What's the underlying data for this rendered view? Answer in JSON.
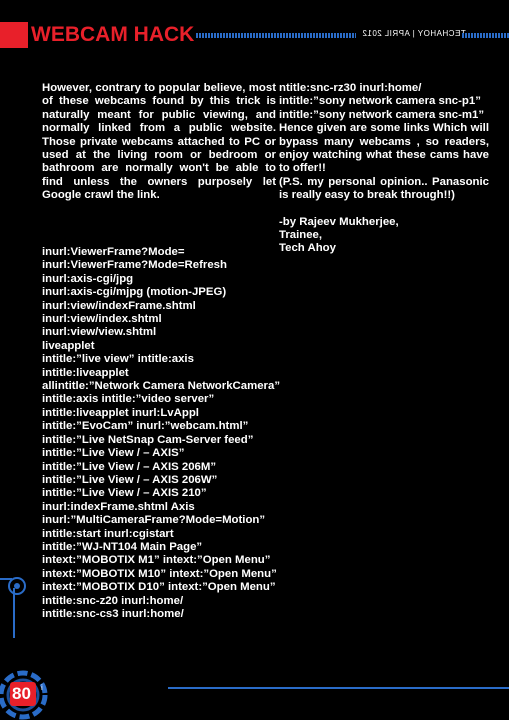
{
  "header": {
    "title": "WEBCAM HACK",
    "issue": "TECHAHOY | APRIL 2012"
  },
  "article": {
    "intro": "However, contrary to popular believe, most of these webcams found by this trick is naturally meant for public viewing, and normally linked from a public website. Those private webcams attached to PC or used at the living room or bedroom or bathroom are normally won't be able to find unless the owners purposely let Google crawl the link.",
    "dorks": [
      "inurl:ViewerFrame?Mode=",
      "inurl:ViewerFrame?Mode=Refresh",
      "inurl:axis-cgi/jpg",
      "inurl:axis-cgi/mjpg (motion-JPEG)",
      "inurl:view/indexFrame.shtml",
      "inurl:view/index.shtml",
      "inurl:view/view.shtml",
      "liveapplet",
      "intitle:”live view” intitle:axis",
      "intitle:liveapplet",
      "allintitle:”Network Camera NetworkCamera”",
      "intitle:axis intitle:”video server”",
      "intitle:liveapplet inurl:LvAppl",
      "intitle:”EvoCam” inurl:”webcam.html”",
      "intitle:”Live NetSnap Cam-Server feed”",
      "intitle:”Live View / – AXIS”",
      "intitle:”Live View / – AXIS 206M”",
      "intitle:”Live View / – AXIS 206W”",
      "intitle:”Live View / – AXIS 210”",
      "inurl:indexFrame.shtml Axis",
      "inurl:”MultiCameraFrame?Mode=Motion”",
      "intitle:start inurl:cgistart",
      "intitle:”WJ-NT104 Main Page”",
      "intext:”MOBOTIX M1” intext:”Open Menu”",
      "intext:”MOBOTIX M10” intext:”Open Menu”",
      "intext:”MOBOTIX D10” intext:”Open Menu”",
      "intitle:snc-z20 inurl:home/",
      "intitle:snc-cs3 inurl:home/"
    ],
    "right_dorks": [
      "ntitle:snc-rz30 inurl:home/",
      "intitle:”sony network camera snc-p1”",
      "intitle:”sony network camera snc-m1”"
    ],
    "closing": "Hence given are some links Which will bypass many webcams , so readers, enjoy watching what these cams have to offer!!",
    "ps": "(P.S. my personal opinion.. Panasonic is really easy to break through!!)",
    "byline": "-by Rajeev Mukherjee,",
    "role": "Trainee,",
    "org": "Tech Ahoy"
  },
  "footer": {
    "page_number": "80",
    "mark": "i"
  },
  "colors": {
    "accent_red": "#e8202a",
    "accent_blue": "#2a6cc8",
    "background": "#000000",
    "text": "#ffffff"
  }
}
